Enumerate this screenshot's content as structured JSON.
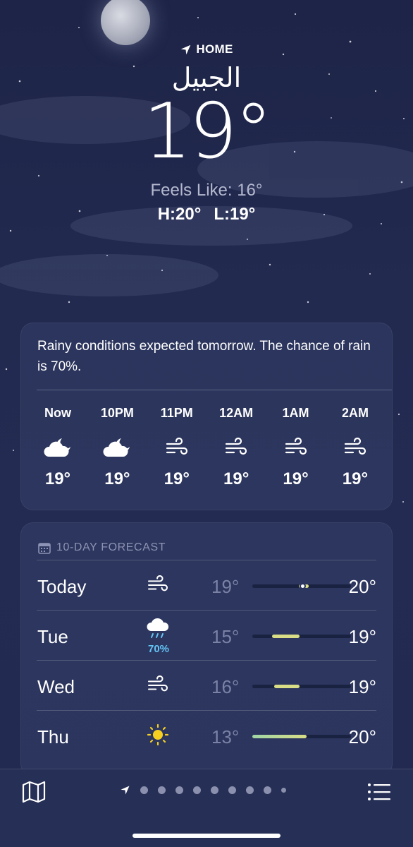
{
  "location": {
    "home_label": "HOME",
    "city": "الجبيل",
    "temperature": "19°",
    "feels_like": "Feels Like: 16°",
    "high": "H:20°",
    "low": "L:19°"
  },
  "hourly": {
    "summary": "Rainy conditions expected tomorrow. The chance of rain is 70%.",
    "hours": [
      {
        "time": "Now",
        "icon": "partly-cloudy-night-icon",
        "temp": "19°"
      },
      {
        "time": "10PM",
        "icon": "partly-cloudy-night-icon",
        "temp": "19°"
      },
      {
        "time": "11PM",
        "icon": "wind-icon",
        "temp": "19°"
      },
      {
        "time": "12AM",
        "icon": "wind-icon",
        "temp": "19°"
      },
      {
        "time": "1AM",
        "icon": "wind-icon",
        "temp": "19°"
      },
      {
        "time": "2AM",
        "icon": "wind-icon",
        "temp": "19°"
      }
    ]
  },
  "forecast": {
    "title": "10-DAY FORECAST",
    "days": [
      {
        "day": "Today",
        "icon": "wind-icon",
        "pop": "",
        "low": "19°",
        "high": "20°",
        "range_start": 0.47,
        "range_end": 0.57,
        "current_marker": true
      },
      {
        "day": "Tue",
        "icon": "rain-cloud-icon",
        "pop": "70%",
        "low": "15°",
        "high": "19°",
        "range_start": 0.2,
        "range_end": 0.48
      },
      {
        "day": "Wed",
        "icon": "wind-icon",
        "pop": "",
        "low": "16°",
        "high": "19°",
        "range_start": 0.22,
        "range_end": 0.48
      },
      {
        "day": "Thu",
        "icon": "sun-icon",
        "pop": "",
        "low": "13°",
        "high": "20°",
        "range_start": 0.0,
        "range_end": 0.55
      }
    ]
  },
  "bottom_bar": {
    "page_count": 9,
    "active_page": 0
  },
  "colors": {
    "accent_rain": "#63c3f5",
    "range_yellow": "#d8dd86",
    "range_green": "#9fd6a6",
    "sun": "#f5d020"
  }
}
